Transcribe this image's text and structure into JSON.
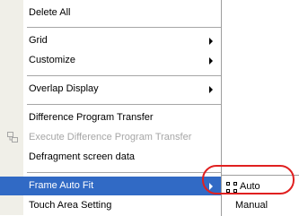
{
  "menu": {
    "items": [
      {
        "label": "Delete All"
      },
      {
        "label": "Grid"
      },
      {
        "label": "Customize"
      },
      {
        "label": "Overlap Display"
      },
      {
        "label": "Difference Program Transfer"
      },
      {
        "label": "Execute Difference Program Transfer"
      },
      {
        "label": "Defragment screen data"
      },
      {
        "label": "Frame Auto Fit"
      },
      {
        "label": "Touch Area Setting"
      }
    ]
  },
  "submenu": {
    "items": [
      {
        "label": "Auto"
      },
      {
        "label": "Manual"
      }
    ]
  },
  "colors": {
    "selection": "#316ac5",
    "highlight_ring": "#e02020",
    "disabled_text": "#a6a6a6"
  }
}
